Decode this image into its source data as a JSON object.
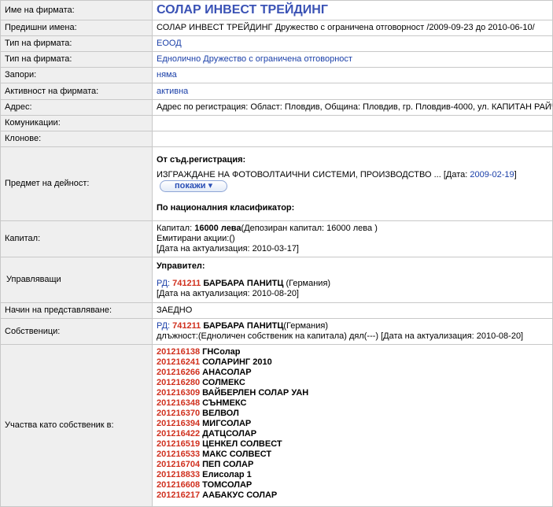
{
  "rows": {
    "name": {
      "label": "Име на фирмата:",
      "value": "СОЛАР ИНВЕСТ ТРЕЙДИНГ"
    },
    "previous": {
      "label": "Предишни имена:",
      "value": "СОЛАР ИНВЕСТ ТРЕЙДИНГ Дружество с ограничена отговорност /2009-09-23 до 2010-06-10/"
    },
    "type1": {
      "label": "Тип на фирмата:",
      "value": "ЕООД"
    },
    "type2": {
      "label": "Тип на фирмата:",
      "value": "Едноличнo Дружество с ограничена отговорност"
    },
    "liens": {
      "label": "Запори:",
      "value": "няма"
    },
    "active": {
      "label": "Активност на фирмата:",
      "value": "активна"
    },
    "address": {
      "label": "Адрес:",
      "value": "Адрес по регистрация: Област: Пловдив, Община: Пловдив, гр. Пловдив-4000, ул. КАПИТАН РАЙЧО"
    },
    "comms": {
      "label": "Комуникации:"
    },
    "branches": {
      "label": "Клонове:"
    },
    "activity": {
      "label": "Предмет на дейност:",
      "heading1": "От съд.регистрация:",
      "text": "ИЗГРАЖДАНЕ НА ФОТОВОЛТАИЧНИ СИСТЕМИ, ПРОИЗВОДСТВО ...",
      "date_prefix": "[Дата:",
      "date": "2009-02-19",
      "date_suffix": "]",
      "toggle": "покажи ▾",
      "heading2": "По националния класификатор:"
    },
    "capital": {
      "label": "Капитал:",
      "line1_prefix": "Капитал:",
      "line1_amount": "16000 лева",
      "line1_suffix": "(Депозиран капитал: 16000 лева )",
      "line2": "Емитирани акции:()",
      "line3": "[Дата на актуализация: 2010-03-17]"
    },
    "managers": {
      "label": "Управляващи",
      "heading": "Управител:",
      "rd": "РД:",
      "id": "741211",
      "person": "БАРБАРА ПАНИТЦ",
      "country": "(Германия)",
      "date": "[Дата на актуализация: 2010-08-20]"
    },
    "representation": {
      "label": "Начин на представляване:",
      "value": "ЗАЕДНО"
    },
    "owners": {
      "label": "Собственици:",
      "rd": "РД:",
      "id": "741211",
      "person": "БАРБАРА ПАНИТЦ",
      "country": "(Германия)",
      "line2": "длъжност:(Едноличен собственик на капитала) дял(---) [Дата на актуализация: 2010-08-20]"
    },
    "participations": {
      "label": "Участва като собственик в:",
      "items": [
        {
          "id": "201216138",
          "name": "ГНСолар"
        },
        {
          "id": "201216241",
          "name": "СОЛАРИНГ 2010"
        },
        {
          "id": "201216266",
          "name": "АНАСОЛАР"
        },
        {
          "id": "201216280",
          "name": "СОЛМЕКС"
        },
        {
          "id": "201216309",
          "name": "ВАЙБЕРЛЕН СОЛАР УАН"
        },
        {
          "id": "201216348",
          "name": "СЪНМЕКС"
        },
        {
          "id": "201216370",
          "name": "ВЕЛВОЛ"
        },
        {
          "id": "201216394",
          "name": "МИГСОЛАР"
        },
        {
          "id": "201216422",
          "name": "ДАТЦСОЛАР"
        },
        {
          "id": "201216519",
          "name": "ЦЕНКЕЛ СОЛВЕСТ"
        },
        {
          "id": "201216533",
          "name": "МАКС СОЛВЕСТ"
        },
        {
          "id": "201216704",
          "name": "ПЕП СОЛАР"
        },
        {
          "id": "201218833",
          "name": "Елисолар 1"
        },
        {
          "id": "201216608",
          "name": "ТОМСОЛАР"
        },
        {
          "id": "201216217",
          "name": "ААБАКУС СОЛАР"
        }
      ]
    }
  }
}
